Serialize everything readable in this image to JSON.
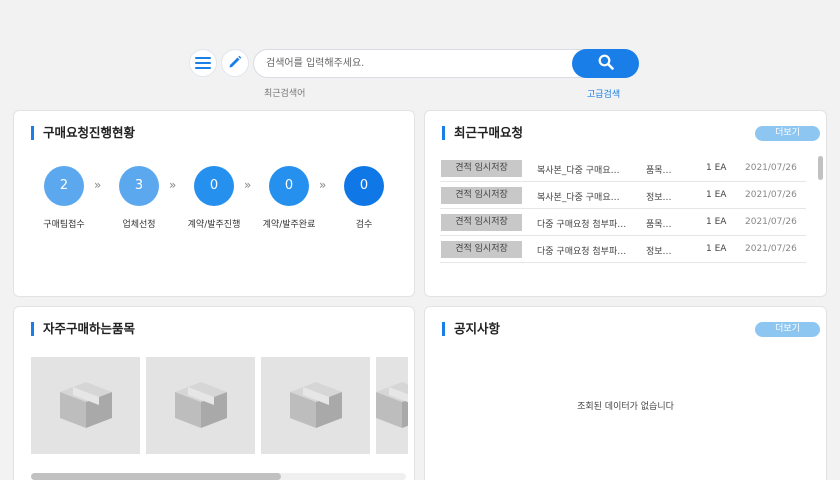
{
  "search": {
    "placeholder": "검색어를 입력해주세요.",
    "recent_label": "최근검색어",
    "advanced_label": "고급검색"
  },
  "icons": {
    "menu": "hamburger-menu-icon",
    "pencil": "pencil-icon",
    "search": "search-icon",
    "product": "box-icon"
  },
  "colors": {
    "accent": "#1a7ee9",
    "step_light": "#5ba8ef",
    "step_mid": "#2690ef",
    "step_dark": "#0f78e6",
    "more_button": "#8ec6f2",
    "badge": "#c8c8c8"
  },
  "progress": {
    "title": "구매요청진행현황",
    "steps": [
      {
        "count": "2",
        "label": "구매팀접수"
      },
      {
        "count": "3",
        "label": "업체선정"
      },
      {
        "count": "0",
        "label": "계약/발주진행"
      },
      {
        "count": "0",
        "label": "계약/발주완료"
      },
      {
        "count": "0",
        "label": "검수"
      }
    ],
    "arrow": "»"
  },
  "recent": {
    "title": "최근구매요청",
    "more_label": "더보기",
    "rows": [
      {
        "status": "견적 임시저장",
        "title": "복사본_다중 구매요…",
        "category": "품목…",
        "qty": "1 EA",
        "date": "2021/07/26"
      },
      {
        "status": "견적 임시저장",
        "title": "복사본_다중 구매요…",
        "category": "정보…",
        "qty": "1 EA",
        "date": "2021/07/26"
      },
      {
        "status": "견적 임시저장",
        "title": "다중 구매요청 첨부파…",
        "category": "품목…",
        "qty": "1 EA",
        "date": "2021/07/26"
      },
      {
        "status": "견적 임시저장",
        "title": "다중 구매요청 첨부파…",
        "category": "정보…",
        "qty": "1 EA",
        "date": "2021/07/26"
      }
    ]
  },
  "frequent": {
    "title": "자주구매하는품목"
  },
  "notice": {
    "title": "공지사항",
    "more_label": "더보기",
    "empty_message": "조회된 데이터가 없습니다"
  }
}
